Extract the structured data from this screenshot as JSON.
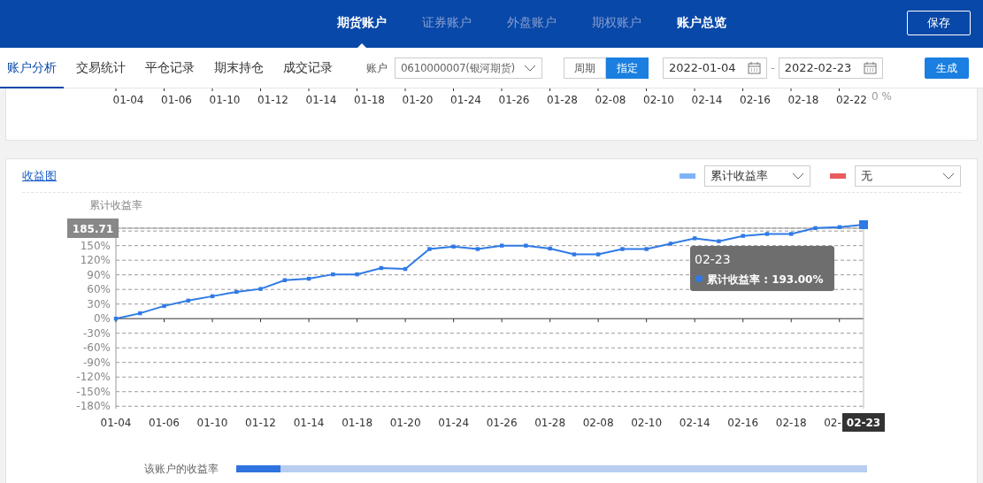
{
  "top_tabs": [
    {
      "label": "期货账户",
      "selected": true,
      "disabled": false
    },
    {
      "label": "证券账户",
      "selected": false,
      "disabled": true
    },
    {
      "label": "外盘账户",
      "selected": false,
      "disabled": true
    },
    {
      "label": "期权账户",
      "selected": false,
      "disabled": true
    },
    {
      "label": "账户总览",
      "selected": false,
      "disabled": false
    }
  ],
  "save_button": "保存",
  "sub_tabs": [
    {
      "label": "账户分析",
      "selected": true
    },
    {
      "label": "交易统计",
      "selected": false
    },
    {
      "label": "平仓记录",
      "selected": false
    },
    {
      "label": "期末持仓",
      "selected": false
    },
    {
      "label": "成交记录",
      "selected": false
    }
  ],
  "account": {
    "label": "账户",
    "value": "0610000007(银河期货)"
  },
  "period_toggle": [
    {
      "label": "周期",
      "selected": false
    },
    {
      "label": "指定",
      "selected": true
    }
  ],
  "date_from": "2022-01-04",
  "date_separator": "-",
  "date_to": "2022-02-23",
  "generate_button": "生成",
  "previous_chart": {
    "x_labels": [
      "01-04",
      "01-06",
      "01-10",
      "01-12",
      "01-14",
      "01-18",
      "01-20",
      "01-24",
      "01-26",
      "01-28",
      "02-08",
      "02-10",
      "02-14",
      "02-16",
      "02-18",
      "02-22"
    ],
    "right_label": "0 %"
  },
  "returns_card": {
    "title": "收益图",
    "legend": [
      {
        "color": "#7fb3f5",
        "value": "累计收益率"
      },
      {
        "color": "#e85c5c",
        "value": "无"
      }
    ],
    "chart_data": {
      "type": "line",
      "ylabel": "累计收益率",
      "categories": [
        "01-04",
        null,
        "01-06",
        null,
        "01-10",
        null,
        "01-12",
        null,
        "01-14",
        null,
        "01-18",
        null,
        "01-20",
        null,
        "01-24",
        null,
        "01-26",
        null,
        "01-28",
        null,
        "02-08",
        null,
        "02-10",
        null,
        "02-14",
        null,
        "02-16",
        null,
        "02-18",
        null,
        "02-",
        null
      ],
      "yticks": [
        {
          "value": 150,
          "label": "150%"
        },
        {
          "value": 120,
          "label": "120%"
        },
        {
          "value": 90,
          "label": "90%"
        },
        {
          "value": 60,
          "label": "60%"
        },
        {
          "value": 30,
          "label": "30%"
        },
        {
          "value": 0,
          "label": "0%"
        },
        {
          "value": -30,
          "label": "-30%"
        },
        {
          "value": -60,
          "label": "-60%"
        },
        {
          "value": -90,
          "label": "-90%"
        },
        {
          "value": -120,
          "label": "-120%"
        },
        {
          "value": -150,
          "label": "-150%"
        },
        {
          "value": -180,
          "label": "-180%"
        }
      ],
      "ylim": [
        -185,
        193
      ],
      "grid": true,
      "ref_lines": [
        {
          "axis": "y",
          "value": 185.71
        }
      ],
      "series": [
        {
          "name": "累计收益率",
          "color": "#2f7ae5",
          "marker": "square",
          "values": [
            0,
            11,
            26,
            37,
            46,
            55,
            61,
            79,
            82,
            91,
            91,
            104,
            102,
            143,
            148,
            143,
            150,
            150,
            144,
            132,
            132,
            143,
            143,
            154,
            165,
            159,
            170,
            174,
            174,
            186,
            188,
            193
          ]
        }
      ]
    },
    "pointer_y_label": "185.71",
    "pointer_x_label": "02-23",
    "tooltip": {
      "title": "02-23",
      "separator": ":",
      "value": "193.00%"
    },
    "bar": {
      "label": "该账户的收益率",
      "level": 0.07
    }
  }
}
